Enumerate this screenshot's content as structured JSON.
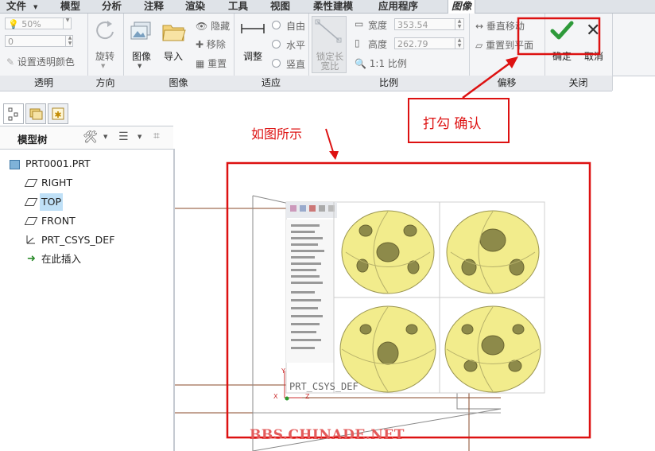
{
  "menu": {
    "items": [
      "文件",
      "模型",
      "分析",
      "注释",
      "渲染",
      "工具",
      "视图",
      "柔性建模",
      "应用程序",
      "图像"
    ]
  },
  "ribbon": {
    "transparency": {
      "percent": "50%",
      "value": "0",
      "set_color": "设置透明颜色"
    },
    "rotate_label": "旋转",
    "image_label": "图像",
    "import_label": "导入",
    "hide_label": "隐藏",
    "remove_label": "移除",
    "reset_label": "重置",
    "adjust_label": "调整",
    "fit": {
      "free": "自由",
      "horizontal": "水平",
      "vertical": "竖直"
    },
    "lock_label_line1": "锁定长",
    "lock_label_line2": "宽比",
    "width_label": "宽度",
    "width_value": "353.54",
    "height_label": "高度",
    "height_value": "262.79",
    "ratio_label": "1:1 比例",
    "vertical_move": "垂直移动",
    "reset_to_plane": "重置到平面",
    "ok_label": "确定",
    "cancel_label": "取消"
  },
  "groups": [
    "透明",
    "方向",
    "图像",
    "适应",
    "比例",
    "偏移",
    "关闭"
  ],
  "left_panel": {
    "tree_title": "模型树",
    "items": [
      {
        "label": "PRT0001.PRT",
        "icon": "part-icon"
      },
      {
        "label": "RIGHT",
        "icon": "datum-plane-icon"
      },
      {
        "label": "TOP",
        "icon": "datum-plane-icon",
        "selected": true
      },
      {
        "label": "FRONT",
        "icon": "datum-plane-icon"
      },
      {
        "label": "PRT_CSYS_DEF",
        "icon": "csys-icon"
      },
      {
        "label": "在此插入",
        "icon": "insert-arrow-icon"
      }
    ]
  },
  "canvas": {
    "csys_label": "PRT_CSYS_DEF",
    "axis_x": "X",
    "axis_y": "Y",
    "axis_z": "Z"
  },
  "annotations": {
    "callout_check": "打勾  确认",
    "callout_image": "如图所示",
    "watermark": "BBS.CHINADE.NET"
  },
  "colors": {
    "annotation_red": "#dd1111",
    "check_green": "#2e9a3a",
    "model_yellow": "#f2ec8c"
  }
}
